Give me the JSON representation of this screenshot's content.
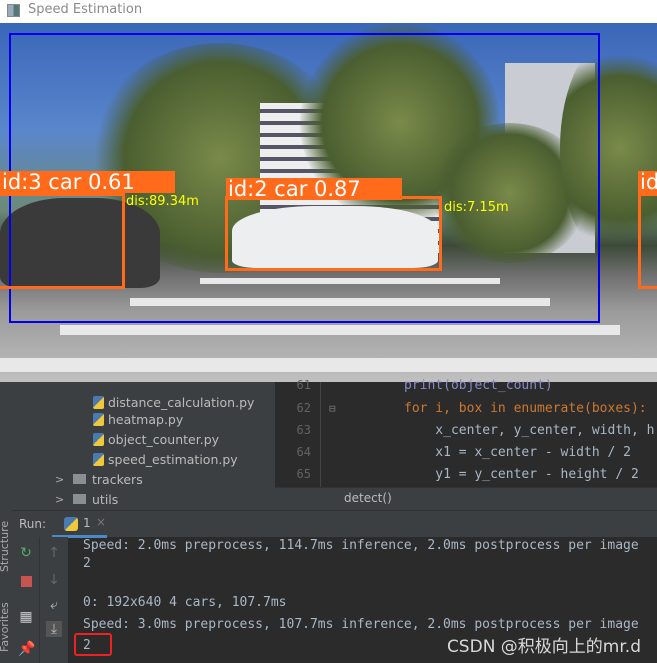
{
  "window": {
    "title": "Speed Estimation"
  },
  "detections": [
    {
      "label": "id:3 car 0.61",
      "distance": "dis:89.34m"
    },
    {
      "label": "id:2 car 0.87",
      "distance": "dis:7.15m"
    },
    {
      "label": "id"
    }
  ],
  "colors": {
    "box": "#ff6b1a",
    "region": "#0000ee",
    "distance_text": "#ffff00",
    "highlight": "#ee2222"
  },
  "project_tree": {
    "items": [
      {
        "name": "distance_calculation.py"
      },
      {
        "name": "heatmap.py"
      },
      {
        "name": "object_counter.py"
      },
      {
        "name": "speed_estimation.py"
      }
    ],
    "folders": [
      {
        "name": "trackers"
      },
      {
        "name": "utils"
      }
    ]
  },
  "editor": {
    "line_numbers": [
      "61",
      "62",
      "63",
      "64",
      "65"
    ],
    "lines": [
      "print(object_count)",
      "for i, box in enumerate(boxes):",
      "    x_center, y_center, width, h",
      "    x1 = x_center - width / 2",
      "    y1 = y_center - height / 2"
    ],
    "breadcrumb": "detect()"
  },
  "run": {
    "label": "Run:",
    "tab": "1",
    "side_tabs": [
      "Structure",
      "Favorites"
    ],
    "console": [
      "Speed: 2.0ms preprocess, 114.7ms inference, 2.0ms postprocess per image",
      "2",
      "",
      "0: 192x640 4 cars, 107.7ms",
      "Speed: 3.0ms preprocess, 107.7ms inference, 2.0ms postprocess per image",
      "2"
    ]
  },
  "watermark": "CSDN @积极向上的mr.d"
}
